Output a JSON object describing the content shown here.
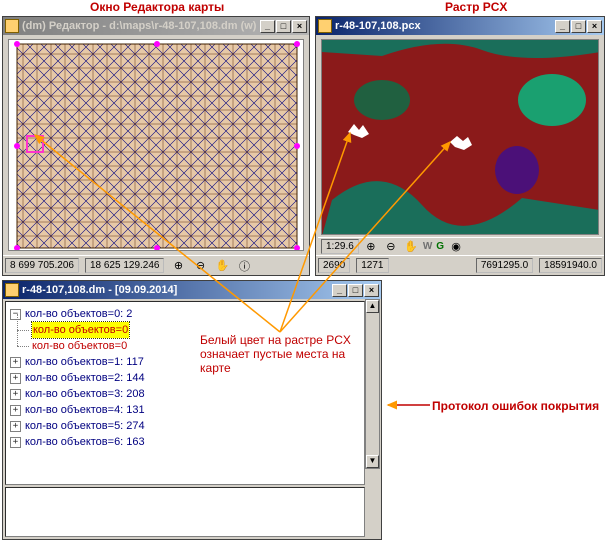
{
  "captions": {
    "editor": "Окно Редактора карты",
    "raster": "Растр PCX"
  },
  "editor": {
    "title": "(dm) Редактор - d:\\maps\\r-48-107,108.dm (w)",
    "status_left": "8 699 705.206",
    "status_mid": "18 625 129.246",
    "btn_min": "_",
    "btn_max": "□",
    "btn_close": "×"
  },
  "raster": {
    "title": "r-48-107,108.pcx",
    "scale": "1:29.6",
    "flag_w": "W",
    "flag_g": "G",
    "pix_x": "2690",
    "pix_y": "1271",
    "geo_x": "7691295.0",
    "geo_y": "18591940.0",
    "btn_min": "_",
    "btn_max": "□",
    "btn_close": "×"
  },
  "log": {
    "title": "r-48-107,108.dm - [09.09.2014]",
    "btn_min": "_",
    "btn_max": "□",
    "btn_close": "×",
    "nodes": [
      {
        "label": "кол-во объектов=0: 2",
        "children": [
          "кол-во объектов=0",
          "кол-во объектов=0"
        ]
      },
      {
        "label": "кол-во объектов=1: 117"
      },
      {
        "label": "кол-во объектов=2: 144"
      },
      {
        "label": "кол-во объектов=3: 208"
      },
      {
        "label": "кол-во объектов=4: 131"
      },
      {
        "label": "кол-во объектов=5: 274"
      },
      {
        "label": "кол-во объектов=6: 163"
      }
    ]
  },
  "annot": {
    "pcx_note_l1": "Белый цвет на растре PCX",
    "pcx_note_l2": "означает пустые места на",
    "pcx_note_l3": "карте",
    "log_arrow": "Протокол ошибок покрытия"
  },
  "icons": {
    "zoom_in": "⊕",
    "zoom_out": "⊖",
    "pan": "✋",
    "info": "ⓘ",
    "view": "◉"
  }
}
